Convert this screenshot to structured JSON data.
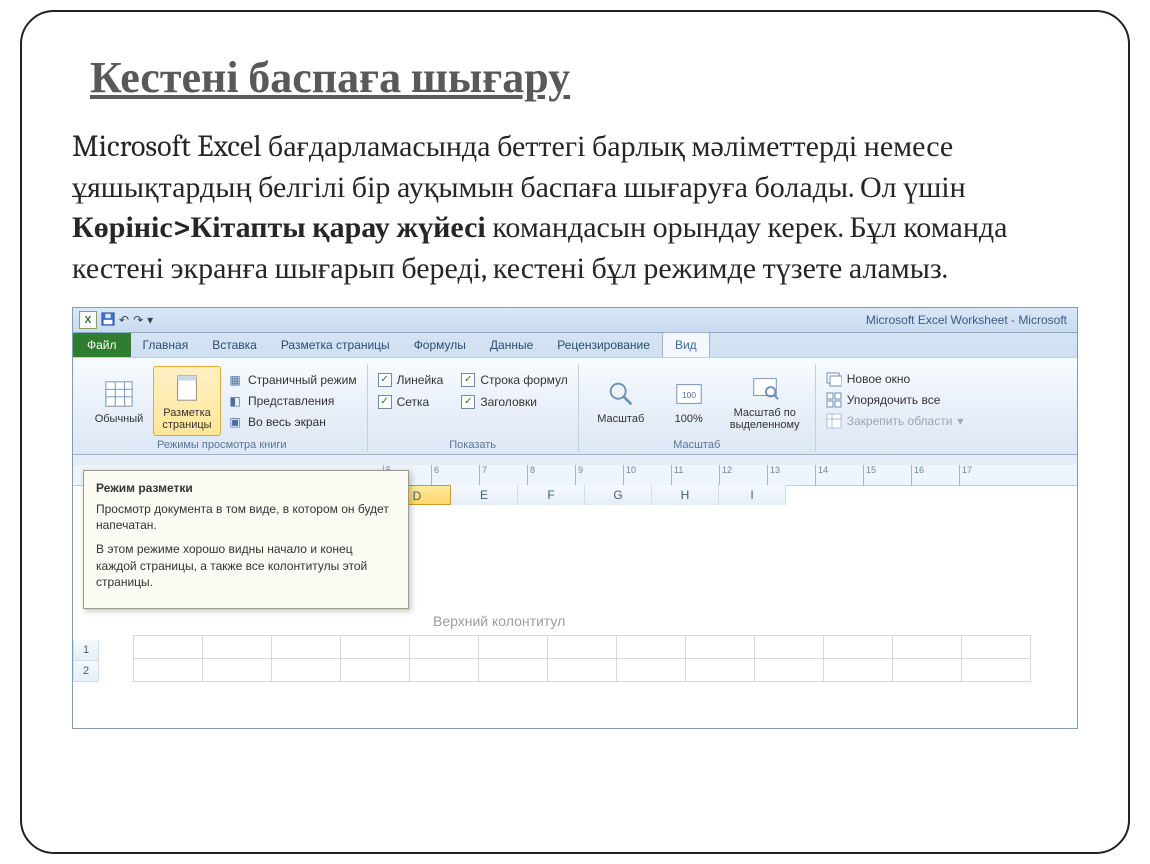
{
  "title": "Кестені баспаға шығару",
  "body": {
    "part1": "Microsoft Excel бағдарламасында беттегі барлық мәліметтерді немесе ұяшықтардың белгілі бір ауқымын баспаға шығаруға болады. Ол үшін ",
    "bold": "Көрініс>Кітапты қарау жүйесі",
    "part2": " командасын орындау керек. Бұл команда кестені экранға шығарып береді, кестені бұл режимде түзете аламыз."
  },
  "excel": {
    "windowTitle": "Microsoft Excel Worksheet - Microsoft",
    "tabs": [
      "Файл",
      "Главная",
      "Вставка",
      "Разметка страницы",
      "Формулы",
      "Данные",
      "Рецензирование",
      "Вид"
    ],
    "views": {
      "normal": "Обычный",
      "pageLayout": "Разметка страницы",
      "pageBreak": "Страничный режим",
      "custom": "Представления",
      "fullscreen": "Во весь экран"
    },
    "show": {
      "ruler": "Линейка",
      "grid": "Сетка",
      "formulaBar": "Строка формул",
      "headings": "Заголовки"
    },
    "zoom": {
      "zoom": "Масштаб",
      "z100": "100%",
      "zSelection": "Масштаб по выделенному"
    },
    "window": {
      "newWin": "Новое окно",
      "arrange": "Упорядочить все",
      "freeze": "Закрепить области"
    },
    "groups": {
      "views": "Режимы просмотра книги",
      "show": "Показать",
      "zoom": "Масштаб"
    },
    "tooltip": {
      "title": "Режим разметки",
      "p1": "Просмотр документа в том виде, в котором он будет напечатан.",
      "p2": "В этом режиме хорошо видны начало и конец каждой страницы, а также все колонтитулы этой страницы."
    },
    "sheet": {
      "rulerTicks": [
        "5",
        "6",
        "7",
        "8",
        "9",
        "10",
        "11",
        "12",
        "13",
        "14",
        "15",
        "16",
        "17"
      ],
      "columns": [
        "D",
        "E",
        "F",
        "G",
        "H",
        "I"
      ],
      "selectedColumn": "D",
      "rows": [
        "1",
        "2"
      ],
      "headerPlaceholder": "Верхний колонтитул"
    }
  }
}
